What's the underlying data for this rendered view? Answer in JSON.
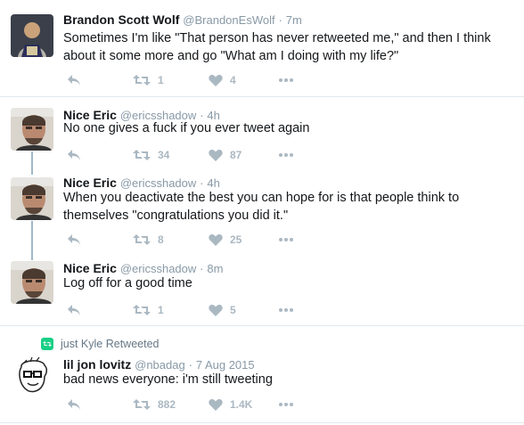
{
  "tweets": [
    {
      "name": "Brandon Scott Wolf",
      "handle": "@BrandonEsWolf",
      "dot": "·",
      "time": "7m",
      "text": "Sometimes I'm like \"That person has never retweeted me,\" and then I think about it some more and go \"What am I doing with my life?\"",
      "retweets": "1",
      "likes": "4"
    },
    {
      "name": "Nice Eric",
      "handle": "@ericsshadow",
      "dot": "·",
      "time": "4h",
      "text": "No one gives a fuck if you ever tweet again",
      "retweets": "34",
      "likes": "87"
    },
    {
      "name": "Nice Eric",
      "handle": "@ericsshadow",
      "dot": "·",
      "time": "4h",
      "text": "When you deactivate the best you can hope for is that people think to themselves \"congratulations you did it.\"",
      "retweets": "8",
      "likes": "25"
    },
    {
      "name": "Nice Eric",
      "handle": "@ericsshadow",
      "dot": "·",
      "time": "8m",
      "text": "Log off for a good time",
      "retweets": "1",
      "likes": "5"
    },
    {
      "name": "lil jon lovitz",
      "handle": "@nbadag",
      "dot": "·",
      "time": "7 Aug 2015",
      "text": "bad news everyone: i'm still tweeting",
      "retweets": "882",
      "likes": "1.4K"
    }
  ],
  "retweet_context": "just Kyle Retweeted",
  "colors": {
    "action_icon": "#aab8c2",
    "retweet_green": "#19cf86",
    "like_gray": "#aab8c2",
    "divider": "#e1e8ed",
    "thread_line": "#a0b8c8"
  }
}
